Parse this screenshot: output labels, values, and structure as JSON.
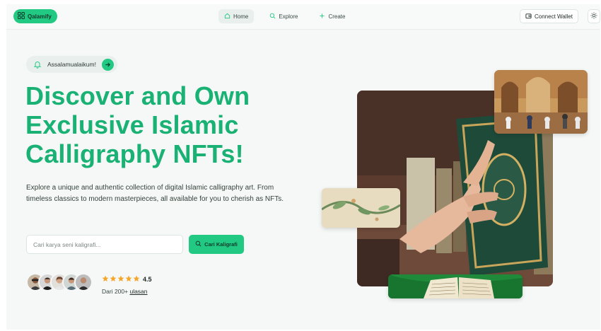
{
  "nav": {
    "brand": "Qalamify",
    "links": [
      {
        "label": "Home",
        "icon": "home-icon",
        "active": true
      },
      {
        "label": "Explore",
        "icon": "search-icon",
        "active": false
      },
      {
        "label": "Create",
        "icon": "plus-icon",
        "active": false
      }
    ],
    "wallet_label": "Connect Wallet",
    "theme_icon": "sun-icon"
  },
  "hero": {
    "greeting": "Assalamualaikum!",
    "headline": [
      "Discover and Own",
      "Exclusive Islamic",
      "Calligraphy NFTs!"
    ],
    "description": "Explore a unique and authentic collection of digital Islamic calligraphy art. From timeless classics to modern masterpieces, all available for you to cherish as NFTs.",
    "search_placeholder": "Cari karya seni kaligrafi...",
    "search_button": "Cari Kaligrafi",
    "rating_value": "4.5",
    "star_count": 5,
    "reviews_prefix": "Dari 200+",
    "reviews_link": "ulasan"
  },
  "colors": {
    "accent": "#22c983",
    "headline": "#1ab274",
    "star": "#f4a72c"
  }
}
